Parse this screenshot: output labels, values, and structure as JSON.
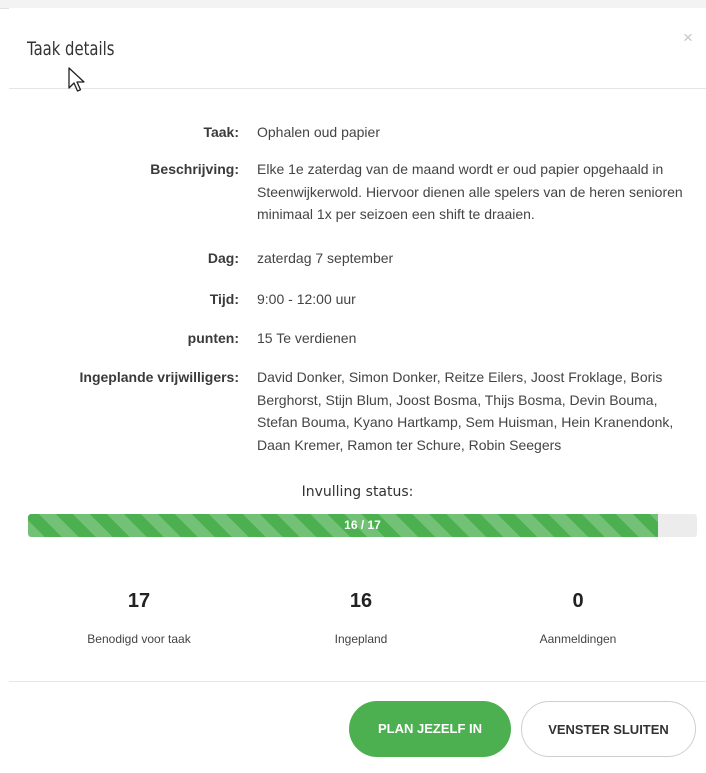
{
  "modal": {
    "title": "Taak details",
    "close_symbol": "×"
  },
  "details": {
    "taak_label": "Taak:",
    "taak_value": "Ophalen oud papier",
    "beschrijving_label": "Beschrijving:",
    "beschrijving_value": "Elke 1e zaterdag van de maand wordt er oud papier opgehaald in Steenwijkerwold. Hiervoor dienen alle spelers van de heren senioren minimaal 1x per seizoen een shift te draaien.",
    "dag_label": "Dag:",
    "dag_value": "zaterdag 7 september",
    "tijd_label": "Tijd:",
    "tijd_value": "9:00 - 12:00 uur",
    "punten_label": "punten:",
    "punten_value": "15 Te verdienen",
    "vrijwilligers_label": "Ingeplande vrijwilligers:",
    "vrijwilligers_value": "David Donker, Simon Donker, Reitze Eilers, Joost Froklage, Boris Berghorst, Stijn Blum, Joost Bosma, Thijs Bosma, Devin Bouma, Stefan Bouma, Kyano Hartkamp, Sem Huisman, Hein Kranendonk, Daan Kremer, Ramon ter Schure, Robin Seegers"
  },
  "status": {
    "title": "Invulling status:",
    "progress_text": "16 / 17",
    "progress_fraction": 0.941,
    "fill_color": "#4cb050"
  },
  "stats": [
    {
      "value": "17",
      "label": "Benodigd voor taak"
    },
    {
      "value": "16",
      "label": "Ingepland"
    },
    {
      "value": "0",
      "label": "Aanmeldingen"
    }
  ],
  "footer": {
    "plan_button": "PLAN JEZELF IN",
    "close_button": "VENSTER SLUITEN"
  },
  "icons": {
    "close": "close-icon",
    "cursor": "mouse-cursor-icon"
  }
}
